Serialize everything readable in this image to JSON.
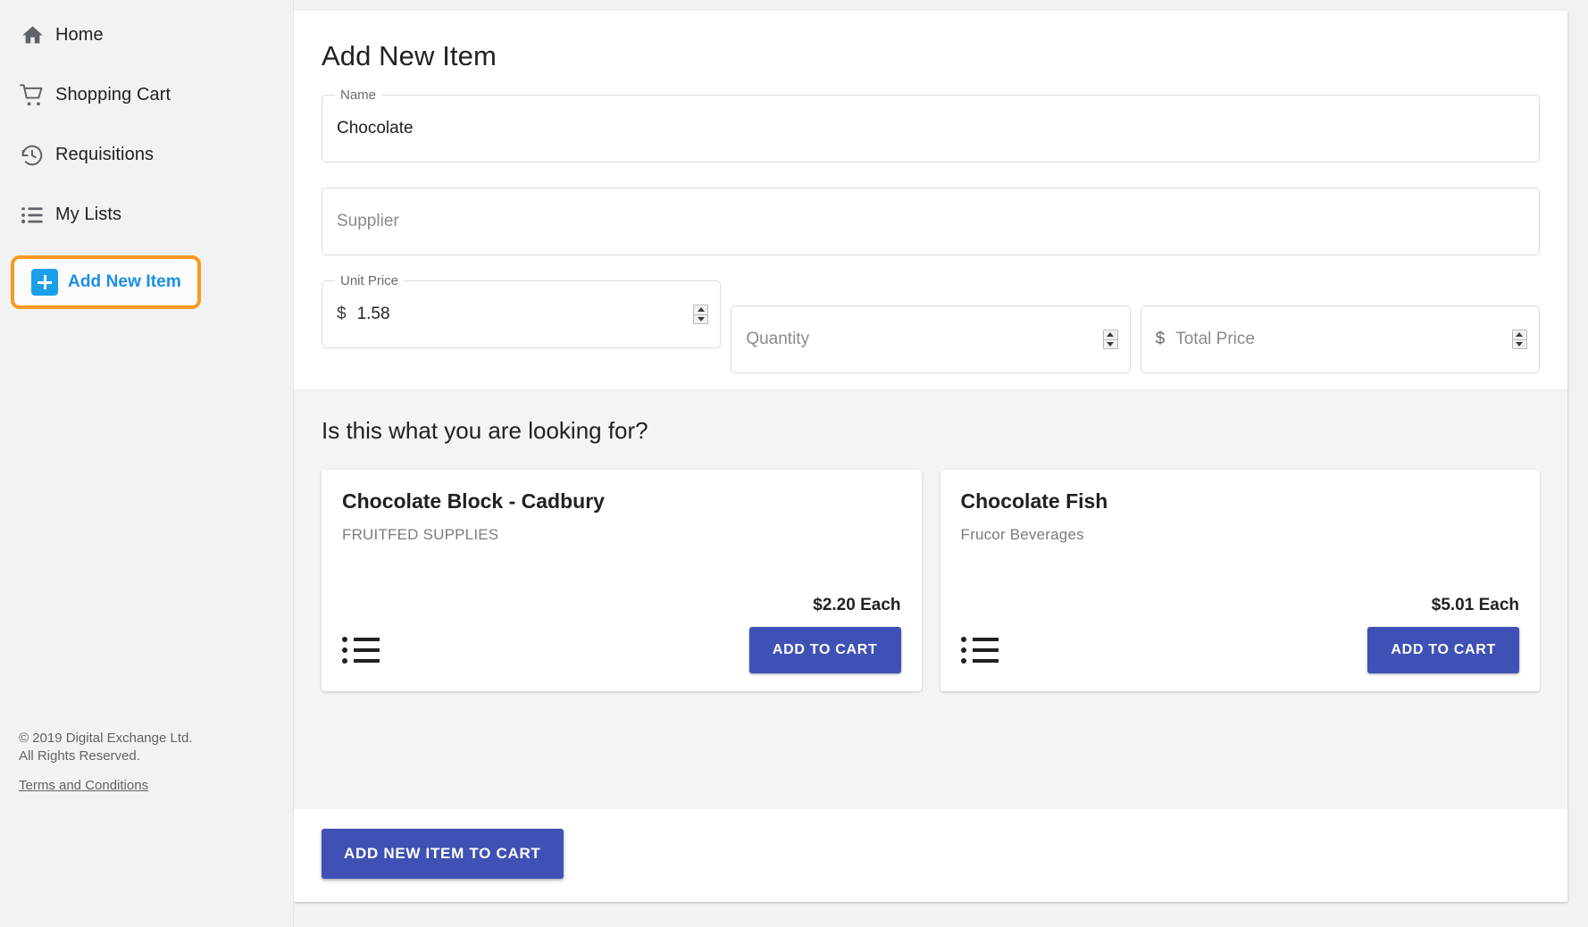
{
  "sidebar": {
    "items": [
      {
        "label": "Home",
        "icon": "home-icon",
        "active": false
      },
      {
        "label": "Shopping Cart",
        "icon": "shopping-cart-icon",
        "active": false
      },
      {
        "label": "Requisitions",
        "icon": "history-clock-icon",
        "active": false
      },
      {
        "label": "My Lists",
        "icon": "list-icon",
        "active": false
      },
      {
        "label": "Add New Item",
        "icon": "plus-square-icon",
        "active": true
      }
    ],
    "footer": {
      "copyright_line1": "© 2019 Digital Exchange Ltd.",
      "copyright_line2": "All Rights Reserved.",
      "terms_link": "Terms and Conditions"
    }
  },
  "form": {
    "title": "Add New Item",
    "name_label": "Name",
    "name_value": "Chocolate",
    "supplier_label": "Supplier",
    "supplier_value": "",
    "supplier_placeholder": "Supplier",
    "unit_price_label": "Unit Price",
    "unit_price_value": "1.58",
    "unit_price_currency": "$",
    "quantity_label": "Quantity",
    "quantity_value": "",
    "quantity_placeholder": "Quantity",
    "total_price_label": "Total Price",
    "total_price_value": "",
    "total_price_placeholder": "Total Price",
    "total_price_currency": "$"
  },
  "suggestions": {
    "heading": "Is this what you are looking for?",
    "cards": [
      {
        "name": "Chocolate Block - Cadbury",
        "supplier": "FRUITFED SUPPLIES",
        "price": "$2.20 Each",
        "add_label": "ADD TO CART",
        "list_icon": "bulleted-list-icon"
      },
      {
        "name": "Chocolate Fish",
        "supplier": "Frucor Beverages",
        "price": "$5.01 Each",
        "add_label": "ADD TO CART",
        "list_icon": "bulleted-list-icon"
      }
    ]
  },
  "actions": {
    "add_new_item_to_cart": "ADD NEW ITEM TO CART"
  },
  "colors": {
    "accent_blue": "#3f51b5",
    "highlight_orange": "#f79a1f",
    "link_blue": "#1a8fe3",
    "plus_badge": "#19a0e8"
  }
}
